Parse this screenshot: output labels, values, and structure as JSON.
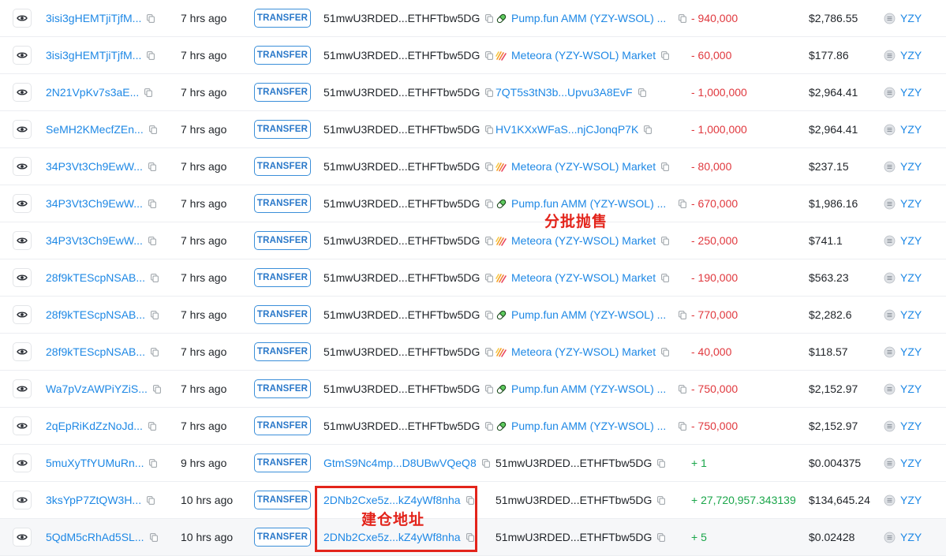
{
  "colors": {
    "link": "#1e88e5",
    "negative": "#e0383e",
    "positive": "#1aa64a",
    "annotation": "#e3241b"
  },
  "icons": {
    "view": "eye-icon",
    "copy": "copy-icon",
    "pumpfun": "pill-icon",
    "meteora": "meteora-icon",
    "token": "token-icon"
  },
  "rows": [
    {
      "signature": "3isi3gHEMTjiTjfM...",
      "time": "7 hrs ago",
      "type": "TRANSFER",
      "from": "51mwU3RDED...ETHFTbw5DG",
      "from_link": false,
      "to": "Pump.fun AMM (YZY-WSOL) ...",
      "to_icon": "pumpfun",
      "amount": "- 940,000",
      "sign": "neg",
      "value": "$2,786.55",
      "token": "YZY"
    },
    {
      "signature": "3isi3gHEMTjiTjfM...",
      "time": "7 hrs ago",
      "type": "TRANSFER",
      "from": "51mwU3RDED...ETHFTbw5DG",
      "from_link": false,
      "to": "Meteora (YZY-WSOL) Market",
      "to_icon": "meteora",
      "amount": "- 60,000",
      "sign": "neg",
      "value": "$177.86",
      "token": "YZY"
    },
    {
      "signature": "2N21VpKv7s3aE...",
      "time": "7 hrs ago",
      "type": "TRANSFER",
      "from": "51mwU3RDED...ETHFTbw5DG",
      "from_link": false,
      "to": "7QT5s3tN3b...Upvu3A8EvF",
      "to_icon": "",
      "amount": "- 1,000,000",
      "sign": "neg",
      "value": "$2,964.41",
      "token": "YZY"
    },
    {
      "signature": "SeMH2KMecfZEn...",
      "time": "7 hrs ago",
      "type": "TRANSFER",
      "from": "51mwU3RDED...ETHFTbw5DG",
      "from_link": false,
      "to": "HV1KXxWFaS...njCJonqP7K",
      "to_icon": "",
      "amount": "- 1,000,000",
      "sign": "neg",
      "value": "$2,964.41",
      "token": "YZY"
    },
    {
      "signature": "34P3Vt3Ch9EwW...",
      "time": "7 hrs ago",
      "type": "TRANSFER",
      "from": "51mwU3RDED...ETHFTbw5DG",
      "from_link": false,
      "to": "Meteora (YZY-WSOL) Market",
      "to_icon": "meteora",
      "amount": "- 80,000",
      "sign": "neg",
      "value": "$237.15",
      "token": "YZY"
    },
    {
      "signature": "34P3Vt3Ch9EwW...",
      "time": "7 hrs ago",
      "type": "TRANSFER",
      "from": "51mwU3RDED...ETHFTbw5DG",
      "from_link": false,
      "to": "Pump.fun AMM (YZY-WSOL) ...",
      "to_icon": "pumpfun",
      "amount": "- 670,000",
      "sign": "neg",
      "value": "$1,986.16",
      "token": "YZY"
    },
    {
      "signature": "34P3Vt3Ch9EwW...",
      "time": "7 hrs ago",
      "type": "TRANSFER",
      "from": "51mwU3RDED...ETHFTbw5DG",
      "from_link": false,
      "to": "Meteora (YZY-WSOL) Market",
      "to_icon": "meteora",
      "amount": "- 250,000",
      "sign": "neg",
      "value": "$741.1",
      "token": "YZY"
    },
    {
      "signature": "28f9kTEScpNSAB...",
      "time": "7 hrs ago",
      "type": "TRANSFER",
      "from": "51mwU3RDED...ETHFTbw5DG",
      "from_link": false,
      "to": "Meteora (YZY-WSOL) Market",
      "to_icon": "meteora",
      "amount": "- 190,000",
      "sign": "neg",
      "value": "$563.23",
      "token": "YZY"
    },
    {
      "signature": "28f9kTEScpNSAB...",
      "time": "7 hrs ago",
      "type": "TRANSFER",
      "from": "51mwU3RDED...ETHFTbw5DG",
      "from_link": false,
      "to": "Pump.fun AMM (YZY-WSOL) ...",
      "to_icon": "pumpfun",
      "amount": "- 770,000",
      "sign": "neg",
      "value": "$2,282.6",
      "token": "YZY"
    },
    {
      "signature": "28f9kTEScpNSAB...",
      "time": "7 hrs ago",
      "type": "TRANSFER",
      "from": "51mwU3RDED...ETHFTbw5DG",
      "from_link": false,
      "to": "Meteora (YZY-WSOL) Market",
      "to_icon": "meteora",
      "amount": "- 40,000",
      "sign": "neg",
      "value": "$118.57",
      "token": "YZY"
    },
    {
      "signature": "Wa7pVzAWPiYZiS...",
      "time": "7 hrs ago",
      "type": "TRANSFER",
      "from": "51mwU3RDED...ETHFTbw5DG",
      "from_link": false,
      "to": "Pump.fun AMM (YZY-WSOL) ...",
      "to_icon": "pumpfun",
      "amount": "- 750,000",
      "sign": "neg",
      "value": "$2,152.97",
      "token": "YZY"
    },
    {
      "signature": "2qEpRiKdZzNoJd...",
      "time": "7 hrs ago",
      "type": "TRANSFER",
      "from": "51mwU3RDED...ETHFTbw5DG",
      "from_link": false,
      "to": "Pump.fun AMM (YZY-WSOL) ...",
      "to_icon": "pumpfun",
      "amount": "- 750,000",
      "sign": "neg",
      "value": "$2,152.97",
      "token": "YZY"
    },
    {
      "signature": "5muXyTfYUMuRn...",
      "time": "9 hrs ago",
      "type": "TRANSFER",
      "from": "GtmS9Nc4mp...D8UBwVQeQ8",
      "from_link": true,
      "to": "51mwU3RDED...ETHFTbw5DG",
      "to_icon": "",
      "amount": "+ 1",
      "sign": "pos",
      "value": "$0.004375",
      "token": "YZY"
    },
    {
      "signature": "3ksYpP7ZtQW3H...",
      "time": "10 hrs ago",
      "type": "TRANSFER",
      "from": "2DNb2Cxe5z...kZ4yWf8nha",
      "from_link": true,
      "to": "51mwU3RDED...ETHFTbw5DG",
      "to_icon": "",
      "amount": "+ 27,720,957.343139",
      "sign": "pos",
      "value": "$134,645.24",
      "token": "YZY"
    },
    {
      "signature": "5QdM5cRhAd5SL...",
      "time": "10 hrs ago",
      "type": "TRANSFER",
      "from": "2DNb2Cxe5z...kZ4yWf8nha",
      "from_link": true,
      "to": "51mwU3RDED...ETHFTbw5DG",
      "to_icon": "",
      "amount": "+ 5",
      "sign": "pos",
      "value": "$0.02428",
      "token": "YZY"
    }
  ],
  "annotations": {
    "batch_sell": "分批抛售",
    "position_address": "建仓地址"
  }
}
